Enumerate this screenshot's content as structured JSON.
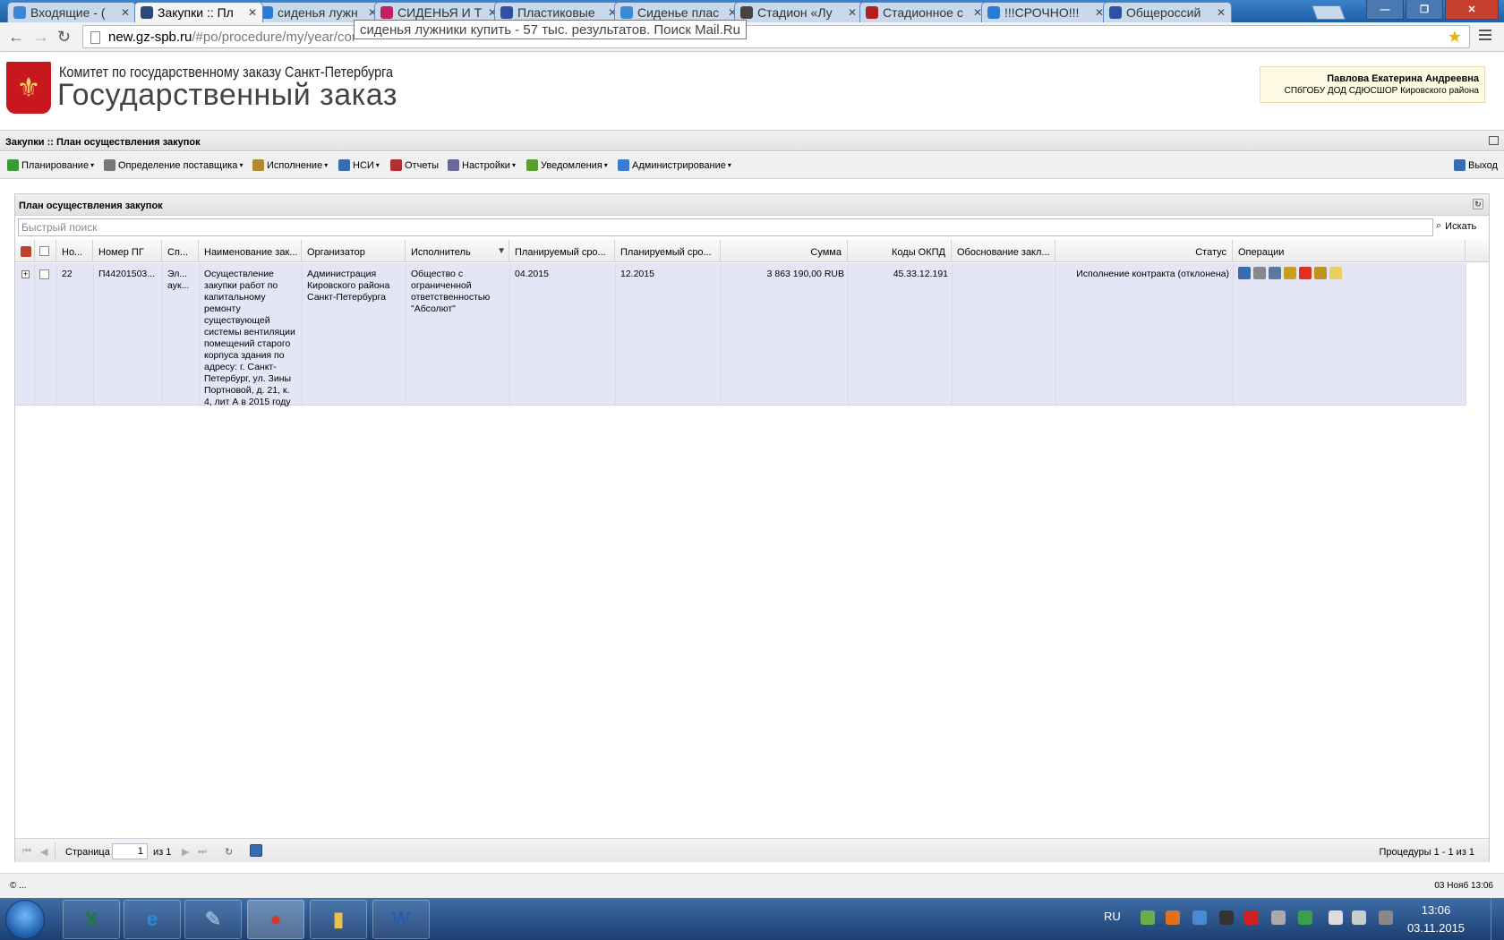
{
  "browser": {
    "tabs": [
      {
        "title": "Входящие - (",
        "icon": "mail-icon",
        "color": "#3d86d6",
        "active": false
      },
      {
        "title": "Закупки :: Пл",
        "icon": "page-icon",
        "color": "#2a4a7a",
        "active": true
      },
      {
        "title": "сиденья лужн",
        "icon": "search-icon",
        "color": "#2a7ad6",
        "active": false
      },
      {
        "title": "СИДЕНЬЯ И Т",
        "icon": "star-icon",
        "color": "#c02060",
        "active": false
      },
      {
        "title": "Пластиковые",
        "icon": "fs-icon",
        "color": "#3050a0",
        "active": false
      },
      {
        "title": "Сиденье плас",
        "icon": "b-icon",
        "color": "#3a8ad6",
        "active": false
      },
      {
        "title": "Стадион «Лу",
        "icon": "ball-icon",
        "color": "#444444",
        "active": false
      },
      {
        "title": "Стадионное с",
        "icon": "seat-icon",
        "color": "#b02020",
        "active": false
      },
      {
        "title": "!!!СРОЧНО!!!",
        "icon": "globe-icon",
        "color": "#2a7ad6",
        "active": false
      },
      {
        "title": "Общероссий",
        "icon": "p-icon",
        "color": "#3050a0",
        "active": false
      }
    ],
    "url_domain": "new.gz-spb.ru",
    "url_path": "/#po/procedure/my/year/cor",
    "tooltip": "сиденья лужники купить - 57 тыс. результатов. Поиск Mail.Ru"
  },
  "header": {
    "org": "Комитет по государственному заказу Санкт-Петербурга",
    "brand": "Государственный заказ",
    "user_name": "Павлова Екатерина Андреевна",
    "user_org": "СПбГОБУ ДОД СДЮСШОР Кировского района"
  },
  "module": {
    "title": "Закупки :: План осуществления закупок"
  },
  "menu": {
    "items": [
      {
        "label": "Планирование",
        "icon": "planning-icon",
        "color": "#3a9a3a",
        "dropdown": true
      },
      {
        "label": "Определение поставщика",
        "icon": "gears-icon",
        "color": "#777777",
        "dropdown": true
      },
      {
        "label": "Исполнение",
        "icon": "execution-icon",
        "color": "#b08a30",
        "dropdown": true
      },
      {
        "label": "НСИ",
        "icon": "book-icon",
        "color": "#3a6ab0",
        "dropdown": true
      },
      {
        "label": "Отчеты",
        "icon": "report-icon",
        "color": "#b03030",
        "dropdown": false
      },
      {
        "label": "Настройки",
        "icon": "wrench-icon",
        "color": "#6a6a9a",
        "dropdown": true
      },
      {
        "label": "Уведомления",
        "icon": "notification-icon",
        "color": "#5aa030",
        "dropdown": true
      },
      {
        "label": "Администрирование",
        "icon": "user-icon",
        "color": "#3a7ad0",
        "dropdown": true
      }
    ],
    "exit_label": "Выход"
  },
  "grid": {
    "title": "План осуществления закупок",
    "search_placeholder": "Быстрый поиск",
    "search_button": "Искать",
    "columns": [
      "Но...",
      "Номер ПГ",
      "Сп...",
      "Наименование зак...",
      "Организатор",
      "Исполнитель",
      "Планируемый сро...",
      "Планируемый сро...",
      "Сумма",
      "Коды ОКПД",
      "Обоснование закл...",
      "Статус",
      "Операции"
    ],
    "rows": [
      {
        "no": "22",
        "pg_number": "П44201503...",
        "method": "Эл... аук...",
        "name": "Осуществление закупки работ по капитальному ремонту существующей системы вентиляции помещений старого корпуса здания по адресу: г. Санкт-Петербург, ул. Зины Портновой, д. 21, к. 4, лит А в 2015 году",
        "organizer": "Администрация Кировского района Санкт-Петербурга",
        "executor": "Общество с ограниченной ответственностью \"Абсолют\"",
        "planned_start": "04.2015",
        "planned_end": "12.2015",
        "sum": "3 863 190,00 RUB",
        "okpd": "45.33.12.191",
        "justification": "",
        "status": "Исполнение контракта (отклонена)",
        "operations": [
          {
            "icon": "chart-icon",
            "color": "#3a6ab0"
          },
          {
            "icon": "gears-icon",
            "color": "#888888"
          },
          {
            "icon": "document-icon",
            "color": "#5a7aa0"
          },
          {
            "icon": "key-icon",
            "color": "#c8a020"
          },
          {
            "icon": "stop-icon",
            "color": "#e03020"
          },
          {
            "icon": "scroll-icon",
            "color": "#c09020"
          },
          {
            "icon": "notes-icon",
            "color": "#e8d060"
          }
        ]
      }
    ],
    "pager": {
      "page_label": "Страница",
      "page_value": "1",
      "of_label": "из 1",
      "summary": "Процедуры 1 - 1 из 1"
    }
  },
  "statusbar": {
    "copyright": "© ...",
    "datetime": "03 Нояб 13:06"
  },
  "taskbar": {
    "apps": [
      {
        "name": "excel",
        "icon": "excel-icon",
        "glyph": "X",
        "color": "#1e7a3a"
      },
      {
        "name": "ie",
        "icon": "ie-icon",
        "glyph": "e",
        "color": "#2a8ae0"
      },
      {
        "name": "paint",
        "icon": "paint-icon",
        "glyph": "✎",
        "color": "#8ab0d0"
      },
      {
        "name": "chrome",
        "icon": "chrome-icon",
        "glyph": "●",
        "color": "#d03a2a"
      },
      {
        "name": "explorer",
        "icon": "folder-icon",
        "glyph": "▮",
        "color": "#e8c050"
      },
      {
        "name": "word",
        "icon": "word-icon",
        "glyph": "W",
        "color": "#2a5ab0"
      }
    ],
    "lang": "RU",
    "time": "13:06",
    "date": "03.11.2015"
  }
}
